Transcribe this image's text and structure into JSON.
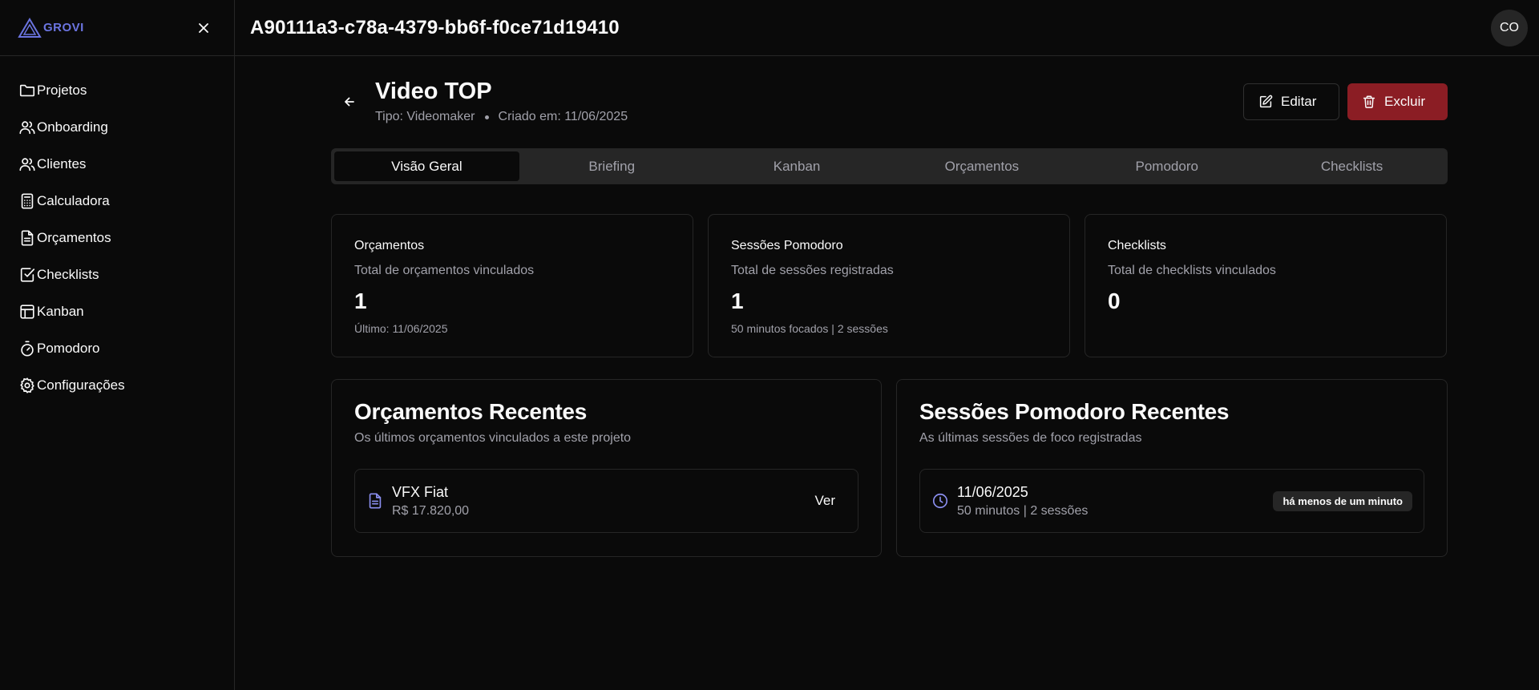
{
  "brand": {
    "name": "GROVI",
    "color": "#6b74e0"
  },
  "sidebar": {
    "items": [
      {
        "label": "Projetos",
        "icon": "folder-icon"
      },
      {
        "label": "Onboarding",
        "icon": "users-icon"
      },
      {
        "label": "Clientes",
        "icon": "users-icon"
      },
      {
        "label": "Calculadora",
        "icon": "calculator-icon"
      },
      {
        "label": "Orçamentos",
        "icon": "file-text-icon"
      },
      {
        "label": "Checklists",
        "icon": "check-square-icon"
      },
      {
        "label": "Kanban",
        "icon": "layout-icon"
      },
      {
        "label": "Pomodoro",
        "icon": "timer-icon"
      },
      {
        "label": "Configurações",
        "icon": "settings-icon"
      }
    ]
  },
  "topbar": {
    "page_id": "A90111a3-c78a-4379-bb6f-f0ce71d19410",
    "avatar": "CO"
  },
  "project": {
    "title": "Video TOP",
    "type": "Tipo: Videomaker",
    "created": "Criado em: 11/06/2025"
  },
  "actions": {
    "edit_label": "Editar",
    "delete_label": "Excluir",
    "danger_color": "#8b1d24"
  },
  "tabs": [
    {
      "label": "Visão Geral",
      "active": true
    },
    {
      "label": "Briefing"
    },
    {
      "label": "Kanban"
    },
    {
      "label": "Orçamentos"
    },
    {
      "label": "Pomodoro"
    },
    {
      "label": "Checklists"
    }
  ],
  "stats": [
    {
      "title": "Orçamentos",
      "desc": "Total de orçamentos vinculados",
      "value": "1",
      "foot": "Último: 11/06/2025"
    },
    {
      "title": "Sessões Pomodoro",
      "desc": "Total de sessões registradas",
      "value": "1",
      "foot": "50 minutos focados | 2 sessões"
    },
    {
      "title": "Checklists",
      "desc": "Total de checklists vinculados",
      "value": "0",
      "foot": ""
    }
  ],
  "recent_budgets": {
    "title": "Orçamentos Recentes",
    "desc": "Os últimos orçamentos vinculados a este projeto",
    "items": [
      {
        "name": "VFX Fiat",
        "amount": "R$ 17.820,00",
        "action": "Ver"
      }
    ]
  },
  "recent_sessions": {
    "title": "Sessões Pomodoro Recentes",
    "desc": "As últimas sessões de foco registradas",
    "items": [
      {
        "date": "11/06/2025",
        "detail": "50 minutos | 2 sessões",
        "badge": "há menos de um minuto"
      }
    ]
  }
}
